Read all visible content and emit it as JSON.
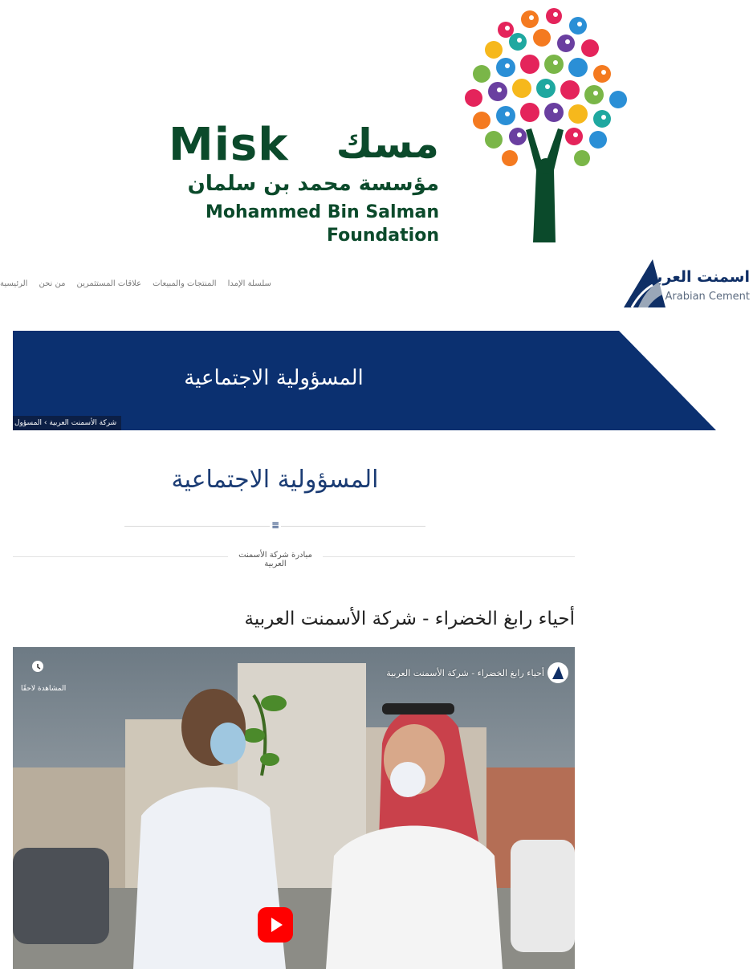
{
  "misk": {
    "title_en": "Misk",
    "title_ar": "مسك",
    "foundation_ar": "مؤسسة محمد بن سلمان",
    "foundation_en_line1": "Mohammed Bin Salman",
    "foundation_en_line2": "Foundation",
    "brand_color": "#0b4a2b"
  },
  "header": {
    "brand_ar": "اسمنت العربية",
    "brand_en": "Arabian Cement",
    "nav": [
      "الرئيسية",
      "من نحن",
      "علاقات المستثمرين",
      "المنتجات والمبيعات",
      "سلسلة الإمدا"
    ]
  },
  "hero": {
    "title": "المسؤولية الاجتماعية",
    "breadcrumb": "شركة الأسمنت العربية › المسؤول",
    "color": "#0b3070"
  },
  "section": {
    "title": "المسؤولية الاجتماعية",
    "divider_icon": "list-icon",
    "subtitle": "مبادرة شركة الأسمنت العربية"
  },
  "video": {
    "heading": "أحياء رابغ الخضراء - شركة الأسمنت العربية",
    "yt_title": "أحياء رابغ الخضراء - شركة الأسمنت العربية",
    "watch_later": "المشاهدة لاحقًا",
    "play_color": "#ff0000"
  }
}
